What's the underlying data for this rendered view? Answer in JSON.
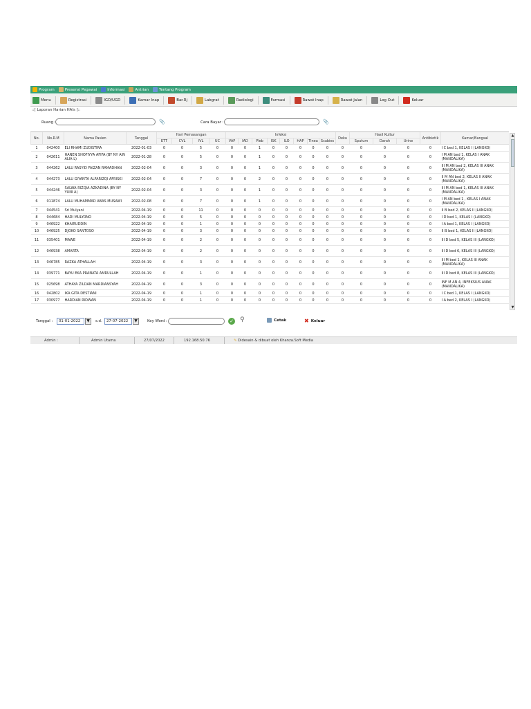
{
  "menubar": {
    "items": [
      {
        "label": "Program",
        "color": "#f0b400"
      },
      {
        "label": "Presensi Pegawai",
        "color": "#d9b36a"
      },
      {
        "label": "Informasi",
        "color": "#4a7bd0"
      },
      {
        "label": "Antrian",
        "color": "#caa45a"
      },
      {
        "label": "Tentang Program",
        "color": "#6a95d8"
      }
    ]
  },
  "toolbar": {
    "items": [
      {
        "label": "Menu",
        "color": "#3f9a4f"
      },
      {
        "label": "Registrasi",
        "color": "#d7a65a"
      },
      {
        "label": "IGD/UGD",
        "color": "#8a8a8a"
      },
      {
        "label": "Kamar Inap",
        "color": "#3c6fb5"
      },
      {
        "label": "Bar.Rj",
        "color": "#c24a2c"
      },
      {
        "label": "Labgrat",
        "color": "#d1a845"
      },
      {
        "label": "Radiologi",
        "color": "#5a9a5a"
      },
      {
        "label": "Farmasi",
        "color": "#3e8e7e"
      },
      {
        "label": "Rawat Inap",
        "color": "#c43a2a"
      },
      {
        "label": "Rawat Jalan",
        "color": "#d6b24a"
      },
      {
        "label": "Log Out",
        "color": "#888888"
      },
      {
        "label": "Keluar",
        "color": "#d12a1e"
      }
    ]
  },
  "panel_title": "::[ Laporan Harian HAIs ]::",
  "filters": {
    "ruang_label": "Ruang :",
    "ruang_value": "",
    "cara_bayar_label": "Cara Bayar :",
    "cara_bayar_value": ""
  },
  "table": {
    "group_headers": {
      "hari_pemasangan": "Hari Pemasangan",
      "infeksi": "Infeksi",
      "hasil_kultur": "Hasil Kultur"
    },
    "headers": {
      "no": "No.",
      "norm": "No.R.M",
      "nama": "Nama Pasien",
      "tanggal": "Tanggal",
      "ett": "ETT",
      "cvl": "CVL",
      "ivl": "IVL",
      "uc": "UC",
      "vap": "VAP",
      "iad": "IAD",
      "pleb": "Pleb",
      "isk": "ISK",
      "ilo": "ILO",
      "hap": "HAP",
      "tinea": "Tinea",
      "scabies": "Scabies",
      "deku": "Deku",
      "sputum": "Sputum",
      "darah": "Darah",
      "urine": "Urine",
      "antibiotik": "Antibiotik",
      "kamar": "Kamar/Bangsal"
    },
    "rows": [
      {
        "no": "1",
        "norm": "042400",
        "nama": "ELI RHAMI ZUDISTIRA",
        "tgl": "2022-01-03",
        "v": [
          "0",
          "0",
          "5",
          "0",
          "0",
          "0",
          "1",
          "0",
          "0",
          "0",
          "0",
          "0",
          "0",
          "0",
          "0",
          "0",
          "0"
        ],
        "kamar": "I C bed 1, KELAS I (LANGKO)"
      },
      {
        "no": "2",
        "norm": "042611",
        "nama": "HANEN SHOFIYYA AFIFA (BY NY AIN ALIA L)",
        "tgl": "2022-01-28",
        "v": [
          "0",
          "0",
          "5",
          "0",
          "0",
          "0",
          "1",
          "0",
          "0",
          "0",
          "0",
          "0",
          "0",
          "0",
          "0",
          "0",
          "0"
        ],
        "kamar": "I M AN bed 1, KELAS I ANAK (MANDALIKA)"
      },
      {
        "no": "3",
        "norm": "044262",
        "nama": "LALU RASYID FAIZAN RAMADHAN",
        "tgl": "2022-02-04",
        "v": [
          "0",
          "0",
          "3",
          "0",
          "0",
          "0",
          "1",
          "0",
          "0",
          "0",
          "0",
          "0",
          "0",
          "0",
          "0",
          "0",
          "0"
        ],
        "kamar": "III M AN bed 2, KELAS III ANAK (MANDALIKA)"
      },
      {
        "no": "4",
        "norm": "044273",
        "nama": "LALU GIYANTA ALFARIZQI AFRISKI",
        "tgl": "2022-02-04",
        "v": [
          "0",
          "0",
          "7",
          "0",
          "0",
          "0",
          "2",
          "0",
          "0",
          "0",
          "0",
          "0",
          "0",
          "0",
          "0",
          "0",
          "0"
        ],
        "kamar": "II M AN bed 2, KELAS II ANAK (MANDALIKA)"
      },
      {
        "no": "5",
        "norm": "044246",
        "nama": "SALWA RIZQIA AZKADINA (BY NY YUNI A)",
        "tgl": "2022-02-04",
        "v": [
          "0",
          "0",
          "3",
          "0",
          "0",
          "0",
          "1",
          "0",
          "0",
          "0",
          "0",
          "0",
          "0",
          "0",
          "0",
          "0",
          "0"
        ],
        "kamar": "III M AN bed 1, KELAS III ANAK (MANDALIKA)"
      },
      {
        "no": "6",
        "norm": "011874",
        "nama": "LALU MUHAMMAD ABAS MUSAWI",
        "tgl": "2022-02-08",
        "v": [
          "0",
          "0",
          "7",
          "0",
          "0",
          "0",
          "1",
          "0",
          "0",
          "0",
          "0",
          "0",
          "0",
          "0",
          "0",
          "0",
          "0"
        ],
        "kamar": "I M AN bed 1 , KELAS I ANAK (MANDALIKA)"
      },
      {
        "no": "7",
        "norm": "044541",
        "nama": "Sri Mulyani",
        "tgl": "2022-04-19",
        "v": [
          "0",
          "0",
          "11",
          "0",
          "0",
          "0",
          "0",
          "0",
          "0",
          "0",
          "0",
          "0",
          "0",
          "0",
          "0",
          "0",
          "0"
        ],
        "kamar": "II B bed 2, KELAS II (LANGKO)"
      },
      {
        "no": "8",
        "norm": "044684",
        "nama": "HADI MULYONO",
        "tgl": "2022-04-19",
        "v": [
          "0",
          "0",
          "5",
          "0",
          "0",
          "0",
          "0",
          "0",
          "0",
          "0",
          "0",
          "0",
          "0",
          "0",
          "0",
          "0",
          "0"
        ],
        "kamar": "I D bed 1, KELAS I (LANGKO)"
      },
      {
        "no": "9",
        "norm": "046922",
        "nama": "KHAIRUDDIN",
        "tgl": "2022-04-19",
        "v": [
          "0",
          "0",
          "1",
          "0",
          "0",
          "0",
          "0",
          "0",
          "0",
          "0",
          "0",
          "0",
          "0",
          "0",
          "0",
          "0",
          "0"
        ],
        "kamar": "I A bed 1, KELAS I (LANGKO)"
      },
      {
        "no": "10",
        "norm": "046925",
        "nama": "DJOKO SANTOSO",
        "tgl": "2022-04-19",
        "v": [
          "0",
          "0",
          "3",
          "0",
          "0",
          "0",
          "0",
          "0",
          "0",
          "0",
          "0",
          "0",
          "0",
          "0",
          "0",
          "0",
          "0"
        ],
        "kamar": "II B bed 1, KELAS II (LANGKO)"
      },
      {
        "no": "11",
        "norm": "035401",
        "nama": "MAWE",
        "tgl": "2022-04-19",
        "v": [
          "0",
          "0",
          "2",
          "0",
          "0",
          "0",
          "0",
          "0",
          "0",
          "0",
          "0",
          "0",
          "0",
          "0",
          "0",
          "0",
          "0"
        ],
        "kamar": "III D bed 5, KELAS III (LANGKO)"
      },
      {
        "no": "12",
        "norm": "046938",
        "nama": "AMARTA",
        "tgl": "2022-04-19",
        "v": [
          "0",
          "0",
          "2",
          "0",
          "0",
          "0",
          "0",
          "0",
          "0",
          "0",
          "0",
          "0",
          "0",
          "0",
          "0",
          "0",
          "0"
        ],
        "kamar": "III D bed 6, KELAS III (LANGKO)"
      },
      {
        "no": "13",
        "norm": "046785",
        "nama": "RAZKA ATHALLAH",
        "tgl": "2022-04-19",
        "v": [
          "0",
          "0",
          "3",
          "0",
          "0",
          "0",
          "0",
          "0",
          "0",
          "0",
          "0",
          "0",
          "0",
          "0",
          "0",
          "0",
          "0"
        ],
        "kamar": "III M bed 1, KELAS III ANAK (MANDALIKA)"
      },
      {
        "no": "14",
        "norm": "039771",
        "nama": "BAYU EKA PRANATA AMRULLAH",
        "tgl": "2022-04-19",
        "v": [
          "0",
          "0",
          "1",
          "0",
          "0",
          "0",
          "0",
          "0",
          "0",
          "0",
          "0",
          "0",
          "0",
          "0",
          "0",
          "0",
          "0"
        ],
        "kamar": "III D bed 8, KELAS III (LANGKO)"
      },
      {
        "no": "15",
        "norm": "025698",
        "nama": "ATHAYA ZILDAN MARDIANSYAH",
        "tgl": "2022-04-19",
        "v": [
          "0",
          "0",
          "3",
          "0",
          "0",
          "0",
          "0",
          "0",
          "0",
          "0",
          "0",
          "0",
          "0",
          "0",
          "0",
          "0",
          "0"
        ],
        "kamar": "INF M AN 4, INFEKSIUS ANAK (MANDALIKA)"
      },
      {
        "no": "16",
        "norm": "042802",
        "nama": "IKA GITA DESTIANI",
        "tgl": "2022-04-19",
        "v": [
          "0",
          "0",
          "1",
          "0",
          "0",
          "0",
          "0",
          "0",
          "0",
          "0",
          "0",
          "0",
          "0",
          "0",
          "0",
          "0",
          "0"
        ],
        "kamar": "I C bed 1, KELAS I (LANGKO)"
      },
      {
        "no": "17",
        "norm": "030977",
        "nama": "HARDIAN RIDWAN",
        "tgl": "2022-04-19",
        "v": [
          "0",
          "0",
          "1",
          "0",
          "0",
          "0",
          "0",
          "0",
          "0",
          "0",
          "0",
          "0",
          "0",
          "0",
          "0",
          "0",
          "0"
        ],
        "kamar": "I A bed 2, KELAS I (LANGKO)"
      }
    ]
  },
  "bottom": {
    "tanggal_label": "Tanggal :",
    "date_from": "01-01-2022",
    "sd_label": "s.d.",
    "date_to": "27-07-2022",
    "keyword_label": "Key Word :",
    "keyword_value": "",
    "cetak_label": "Cetak",
    "keluar_label": "Keluar"
  },
  "status": {
    "user": "Admin :",
    "role": "Admin Utama",
    "date": "27/07/2022",
    "ip": "192.168.50.76",
    "credit": "Didesain & dibuat oleh Khanza.Soft Media"
  }
}
